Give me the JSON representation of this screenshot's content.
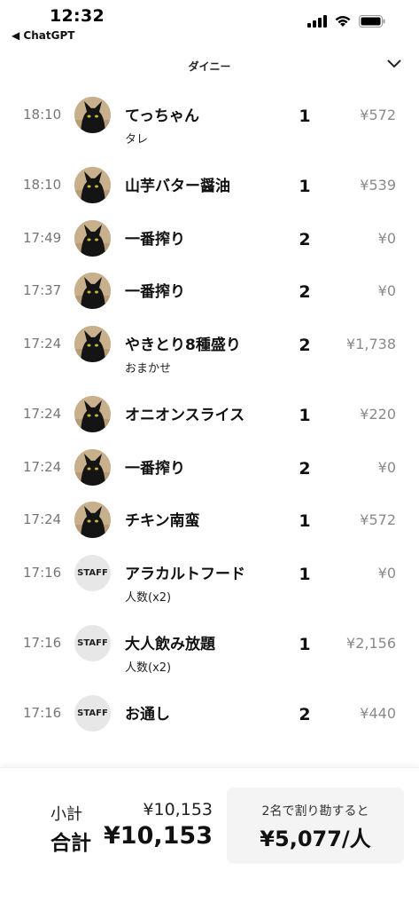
{
  "status_bar": {
    "time": "12:32",
    "back_app": "◀ ChatGPT"
  },
  "header": {
    "title": "ダイニー"
  },
  "orders": [
    {
      "time": "18:10",
      "avatar": "cat",
      "name": "てっちゃん",
      "note": "タレ",
      "qty": "1",
      "price": "¥572"
    },
    {
      "time": "18:10",
      "avatar": "cat",
      "name": "山芋バター醤油",
      "note": "",
      "qty": "1",
      "price": "¥539"
    },
    {
      "time": "17:49",
      "avatar": "cat",
      "name": "一番搾り",
      "note": "",
      "qty": "2",
      "price": "¥0"
    },
    {
      "time": "17:37",
      "avatar": "cat",
      "name": "一番搾り",
      "note": "",
      "qty": "2",
      "price": "¥0"
    },
    {
      "time": "17:24",
      "avatar": "cat",
      "name": "やきとり8種盛り",
      "note": "おまかせ",
      "qty": "2",
      "price": "¥1,738"
    },
    {
      "time": "17:24",
      "avatar": "cat",
      "name": "オニオンスライス",
      "note": "",
      "qty": "1",
      "price": "¥220"
    },
    {
      "time": "17:24",
      "avatar": "cat",
      "name": "一番搾り",
      "note": "",
      "qty": "2",
      "price": "¥0"
    },
    {
      "time": "17:24",
      "avatar": "cat",
      "name": "チキン南蛮",
      "note": "",
      "qty": "1",
      "price": "¥572"
    },
    {
      "time": "17:16",
      "avatar": "staff",
      "name": "アラカルトフード",
      "note": "人数(x2)",
      "qty": "1",
      "price": "¥0"
    },
    {
      "time": "17:16",
      "avatar": "staff",
      "name": "大人飲み放題",
      "note": "人数(x2)",
      "qty": "1",
      "price": "¥2,156"
    },
    {
      "time": "17:16",
      "avatar": "staff",
      "name": "お通し",
      "note": "",
      "qty": "2",
      "price": "¥440"
    }
  ],
  "staff_label": "STAFF",
  "footer": {
    "subtotal_label": "小計",
    "subtotal_value": "¥10,153",
    "total_label": "合計",
    "total_value": "¥10,153",
    "split_caption": "2名で割り勘すると",
    "split_value": "¥5,077/人"
  }
}
